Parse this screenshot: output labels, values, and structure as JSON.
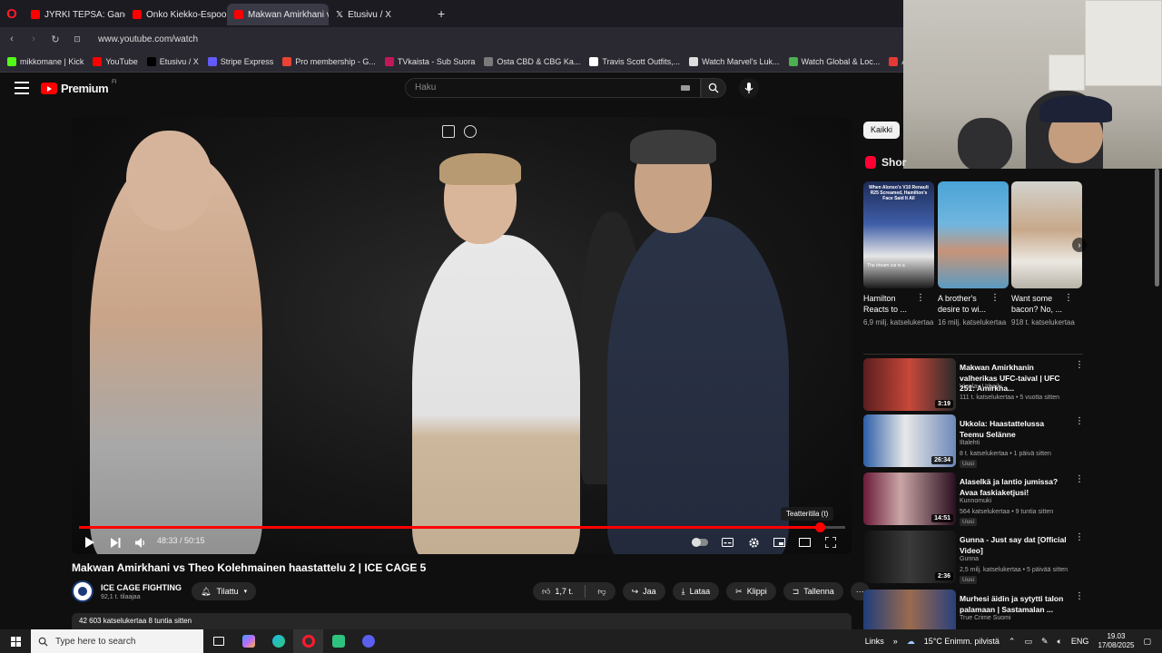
{
  "browser": {
    "tabs": [
      {
        "label": "JYRKI TEPSA: Gangsterieli",
        "icon": "youtube-icon",
        "active": false
      },
      {
        "label": "Onko Kiekko-Espoon roni",
        "icon": "youtube-icon",
        "active": false
      },
      {
        "label": "Makwan Amirkhani vs Th",
        "icon": "youtube-icon",
        "active": true
      },
      {
        "label": "Etusivu / X",
        "icon": "x-icon",
        "active": false
      }
    ],
    "new_tab": "+",
    "url": "www.youtube.com/watch",
    "bookmarks": [
      {
        "label": "mikkomane | Kick",
        "color": "#53fc18"
      },
      {
        "label": "YouTube",
        "color": "#ff0000"
      },
      {
        "label": "Etusivu / X",
        "color": "#000000"
      },
      {
        "label": "Stripe Express",
        "color": "#635bff"
      },
      {
        "label": "Pro membership - G...",
        "color": "#ea4335"
      },
      {
        "label": "TVkaista - Sub Suora",
        "color": "#c2185b"
      },
      {
        "label": "Osta CBD & CBG Ka...",
        "color": "#7a7a7a"
      },
      {
        "label": "Travis Scott Outfits,...",
        "color": "#ffffff"
      },
      {
        "label": "Watch Marvel's Luk...",
        "color": "#dddddd"
      },
      {
        "label": "Watch Global & Loc...",
        "color": "#4caf50"
      },
      {
        "label": "A$AP ROCKY x PU...",
        "color": "#e53935"
      }
    ]
  },
  "youtube": {
    "logo_text": "Premium",
    "region": "FI",
    "search_placeholder": "Haku"
  },
  "video": {
    "current_time": "48:33 / 50:15",
    "progress": 0.967,
    "tooltip": "Teatteritila (t)",
    "title": "Makwan Amirkhani vs Theo Kolehmainen haastattelu 2 | ICE CAGE 5",
    "channel": "ICE CAGE FIGHTING",
    "subscribers": "92,1 t. tilaajaa",
    "subscribe_label": "Tilattu",
    "likes": "1,7 t.",
    "share": "Jaa",
    "download": "Lataa",
    "clip": "Klippi",
    "save": "Tallenna",
    "views_line": "42 603 katselukertaa  8 tuntia sitten"
  },
  "sidebar": {
    "chip": "Kaikki",
    "shorts_heading": "Shor",
    "shorts": [
      {
        "title": "Hamilton Reacts to ...",
        "views": "6,9 milj. katselukertaa",
        "overlay": "When Alonso's V10 Renault R25 Screamed, Hamilton's Face Said It All",
        "caption": "The dream car is a"
      },
      {
        "title": "A brother's desire to wi...",
        "views": "16 milj. katselukertaa"
      },
      {
        "title": "Want some bacon? No, ...",
        "views": "918 t. katselukertaa"
      }
    ],
    "recommended": [
      {
        "title": "Makwan Amirkhanin valherikas UFC-taival | UFC 251: Amirkha...",
        "channel": "Viaplay Urheilu",
        "meta": "111 t. katselukertaa • 5 vuotta sitten",
        "duration": "3:19",
        "badge": ""
      },
      {
        "title": "Ukkola: Haastattelussa Teemu Selänne",
        "channel": "Iltalehti",
        "meta": "8 t. katselukertaa • 1 päivä sitten",
        "duration": "26:34",
        "badge": "Uusi"
      },
      {
        "title": "Alaselkä ja lantio jumissa? Avaa faskiaketjusi!",
        "channel": "Kunnomuki",
        "meta": "564 katselukertaa • 9 tuntia sitten",
        "duration": "14:51",
        "badge": "Uusi"
      },
      {
        "title": "Gunna - Just say dat [Official Video]",
        "channel": "Gunna",
        "meta": "2,5 milj. katselukertaa • 5 päivää sitten",
        "duration": "2:36",
        "badge": "Uusi"
      },
      {
        "title": "Murhesi äidin ja sytytti talon palamaan | Sastamalan ...",
        "channel": "True Crime Suomi",
        "meta": "",
        "duration": "",
        "badge": ""
      }
    ]
  },
  "taskbar": {
    "search_placeholder": "Type here to search",
    "links": "Links",
    "weather": "15°C  Enimm. pilvistä",
    "lang": "ENG",
    "time": "19.03",
    "date": "17/08/2025"
  }
}
